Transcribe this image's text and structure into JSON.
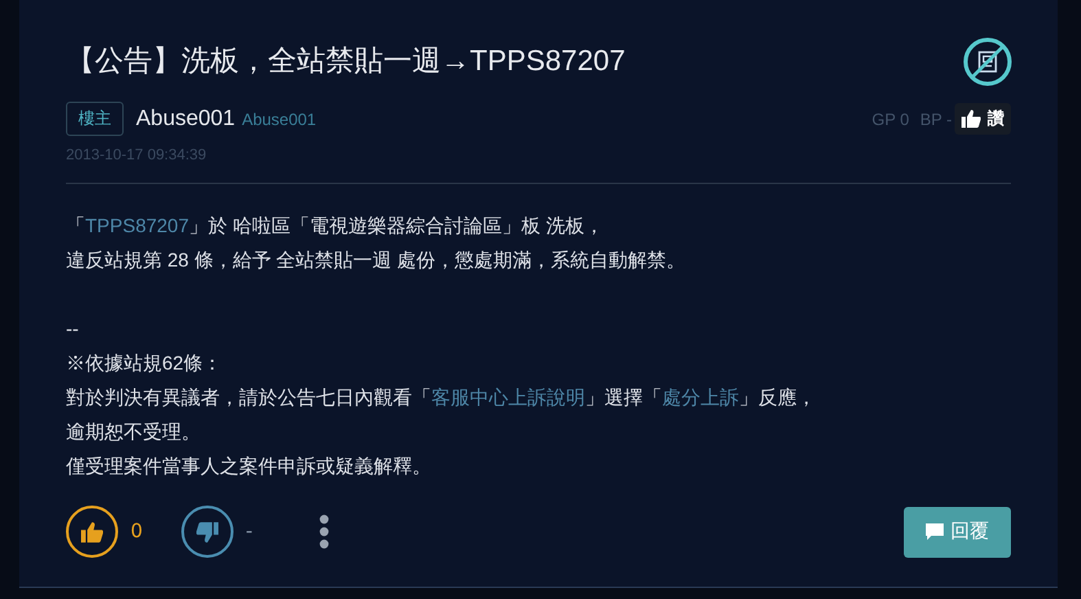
{
  "post": {
    "title": "【公告】洗板，全站禁貼一週→TPPS87207",
    "author_badge": "樓主",
    "author_name": "Abuse001",
    "author_id": "Abuse001",
    "timestamp": "2013-10-17 09:34:39",
    "gp": "GP 0",
    "bp": "BP -",
    "praise_button": "讚",
    "paragraphs": [
      {
        "kind": "line",
        "segments": [
          {
            "kind": "text",
            "text": "「"
          },
          {
            "kind": "link",
            "text": "TPPS87207"
          },
          {
            "kind": "text",
            "text": "」於 哈啦區「電視遊樂器綜合討論區」板 洗板，"
          }
        ]
      },
      {
        "kind": "line",
        "segments": [
          {
            "kind": "text",
            "text": "違反站規第 28 條，給予 全站禁貼一週 處份，懲處期滿，系統自動解禁。"
          }
        ]
      },
      {
        "kind": "signature",
        "segments": [
          {
            "kind": "text",
            "text": "--"
          }
        ]
      },
      {
        "kind": "line",
        "segments": [
          {
            "kind": "text",
            "text": "※依據站規62條："
          }
        ]
      },
      {
        "kind": "line",
        "segments": [
          {
            "kind": "text",
            "text": "對於判決有異議者，請於公告七日內觀看「"
          },
          {
            "kind": "link",
            "text": "客服中心上訴說明"
          },
          {
            "kind": "text",
            "text": "」選擇「"
          },
          {
            "kind": "link",
            "text": "處分上訴"
          },
          {
            "kind": "text",
            "text": "」反應，"
          }
        ]
      },
      {
        "kind": "line",
        "segments": [
          {
            "kind": "text",
            "text": "逾期恕不受理。"
          }
        ]
      },
      {
        "kind": "line",
        "segments": [
          {
            "kind": "text",
            "text": "僅受理案件當事人之案件申訴或疑義解釋。"
          }
        ]
      }
    ],
    "gp_count": "0",
    "bp_count": "-",
    "reply_button": "回覆"
  }
}
